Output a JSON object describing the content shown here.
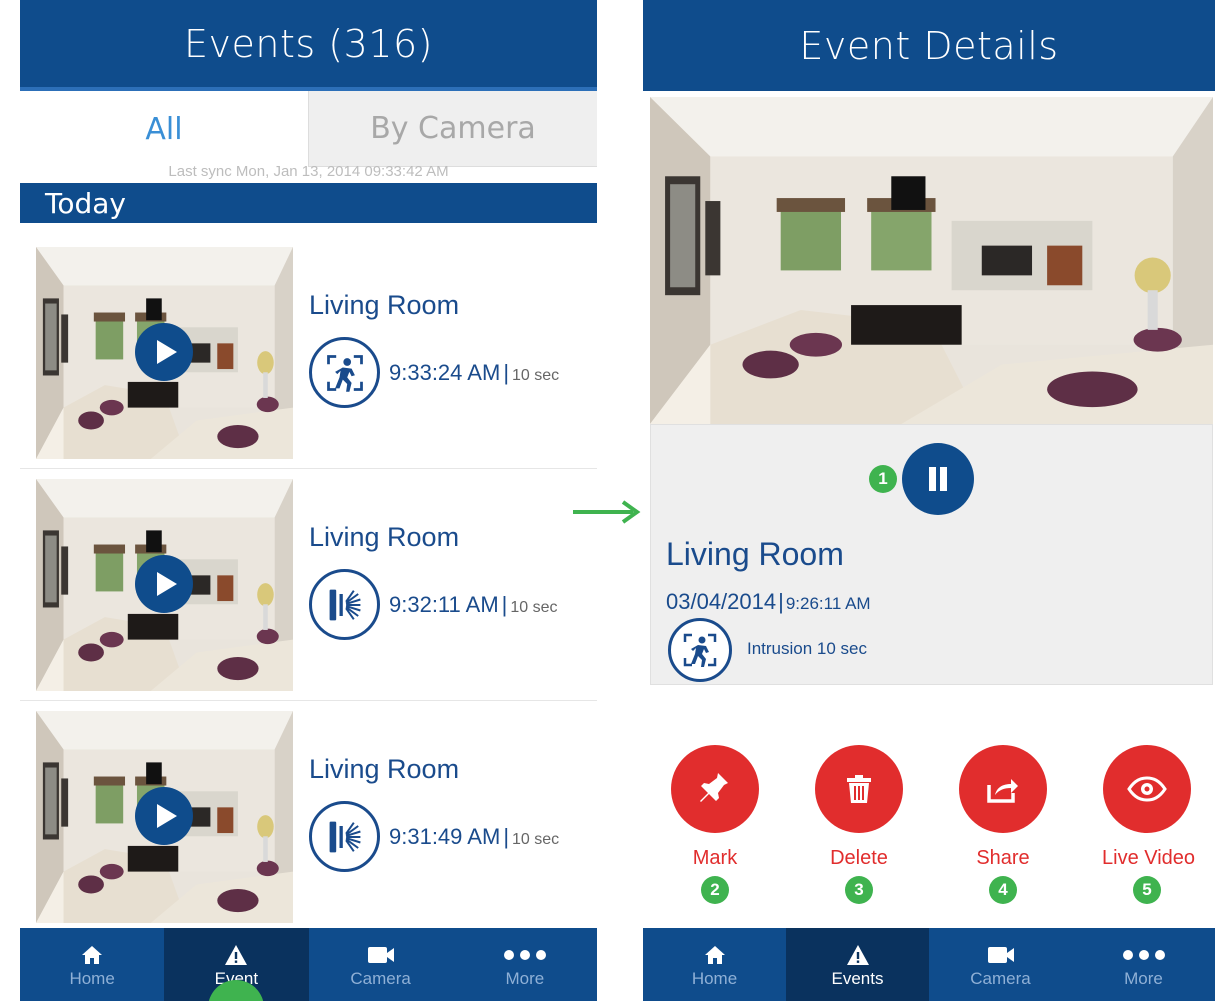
{
  "colors": {
    "brand_blue": "#0f4c8c",
    "tab_active": "#3a8fd6",
    "action_red": "#e12d2d",
    "badge_green": "#3fb34f"
  },
  "left": {
    "title": "Events (316)",
    "tabs": [
      {
        "label": "All",
        "active": true
      },
      {
        "label": "By Camera",
        "active": false
      }
    ],
    "sync": "Last sync Mon, Jan 13, 2014 09:33:42 AM",
    "section": "Today",
    "events": [
      {
        "title": "Living Room",
        "icon": "intrusion-icon",
        "time": "9:33:24 AM",
        "sep": "|",
        "duration": "10 sec"
      },
      {
        "title": "Living Room",
        "icon": "door-sensor-icon",
        "time": "9:32:11 AM",
        "sep": "|",
        "duration": "10 sec"
      },
      {
        "title": "Living Room",
        "icon": "door-sensor-icon",
        "time": "9:31:49 AM",
        "sep": "|",
        "duration": "10 sec"
      }
    ],
    "nav": [
      {
        "label": "Home",
        "icon": "home-icon",
        "active": false
      },
      {
        "label": "Event",
        "icon": "warning-icon",
        "active": true
      },
      {
        "label": "Camera",
        "icon": "camera-icon",
        "active": false
      },
      {
        "label": "More",
        "icon": "more-icon",
        "active": false
      }
    ]
  },
  "right": {
    "title": "Event Details",
    "pause_badge": "1",
    "event_title": "Living Room",
    "date": "03/04/2014",
    "sep": "|",
    "time": "9:26:11 AM",
    "type": "Intrusion 10 sec",
    "actions": [
      {
        "label": "Mark",
        "icon": "pin-icon",
        "badge": "2"
      },
      {
        "label": "Delete",
        "icon": "trash-icon",
        "badge": "3"
      },
      {
        "label": "Share",
        "icon": "share-icon",
        "badge": "4"
      },
      {
        "label": "Live Video",
        "icon": "eye-icon",
        "badge": "5"
      }
    ],
    "nav": [
      {
        "label": "Home",
        "icon": "home-icon",
        "active": false
      },
      {
        "label": "Events",
        "icon": "warning-icon",
        "active": true
      },
      {
        "label": "Camera",
        "icon": "camera-icon",
        "active": false
      },
      {
        "label": "More",
        "icon": "more-icon",
        "active": false
      }
    ]
  }
}
